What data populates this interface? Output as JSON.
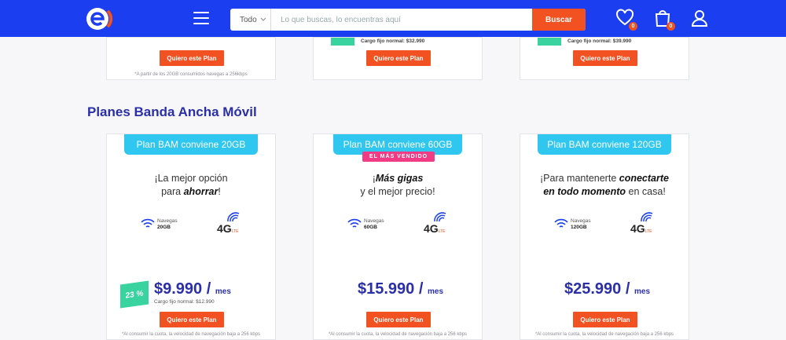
{
  "header": {
    "search": {
      "category": "Todo",
      "placeholder": "Lo que buscas, lo encuentras aquí",
      "button": "Buscar"
    },
    "favorites_count": "0",
    "cart_count": "0"
  },
  "top_cards": [
    {
      "note": "*A partir de los 20GB consumidos navegas a 256kbps",
      "button": "Quiero este Plan"
    },
    {
      "fixed": "Cargo fijo normal: $32.990",
      "button": "Quiero este Plan"
    },
    {
      "fixed": "Cargo fijo normal: $39.990",
      "button": "Quiero este Plan"
    }
  ],
  "section_title": "Planes Banda Ancha Móvil",
  "plans": [
    {
      "tag": "Plan BAM conviene 20GB",
      "headline_1": "¡La mejor opción",
      "headline_2a": "para ",
      "headline_2b": "ahorrar",
      "headline_2c": "!",
      "nav_label": "Navegas",
      "nav_value": "20GB",
      "network": "4G",
      "network_sub": "LTE",
      "discount": "23 %",
      "price": "$9.990 /",
      "per": "mes",
      "fixed": "Cargo fijo normal: $12.990",
      "button": "Quiero este Plan",
      "note": "*Al consumir la cuota, la velocidad de navegación baja a 256 kbps"
    },
    {
      "tag": "Plan BAM conviene 60GB",
      "badge": "EL MÁS VENDIDO",
      "headline_1a": "¡",
      "headline_1b": "Más gigas",
      "headline_2": "y el mejor precio!",
      "nav_label": "Navegas",
      "nav_value": "60GB",
      "network": "4G",
      "network_sub": "LTE",
      "price": "$15.990 /",
      "per": "mes",
      "button": "Quiero este Plan",
      "note": "*Al consumir la cuota, la velocidad de navegación baja a 256 kbps"
    },
    {
      "tag": "Plan BAM conviene 120GB",
      "headline_1a": "¡Para mantenerte ",
      "headline_1b": "conectarte",
      "headline_2a": "en todo momento",
      "headline_2b": " en casa!",
      "nav_label": "Navegas",
      "nav_value": "120GB",
      "network": "4G",
      "network_sub": "LTE",
      "price": "$25.990 /",
      "per": "mes",
      "button": "Quiero este Plan",
      "note": "*Al consumir la cuota, la velocidad de navegación baja a 256 kbps"
    }
  ],
  "colors": {
    "brand_blue": "#1a3ef0",
    "accent_orange": "#f25122",
    "title_blue": "#2a2fa8",
    "tag_cyan": "#2fc7ef",
    "bestseller_pink": "#f23b85",
    "discount_green": "#38d39f"
  }
}
